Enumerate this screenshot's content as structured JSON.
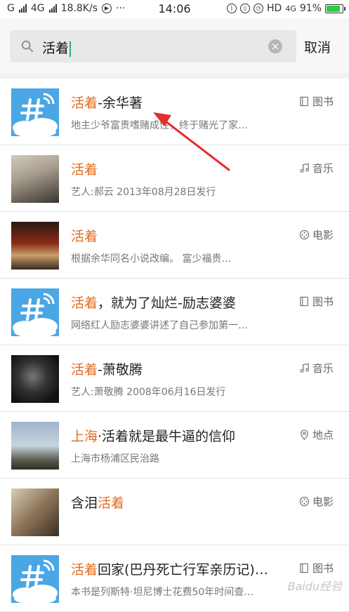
{
  "status_bar": {
    "carrier_left": "G",
    "network": "4G",
    "speed": "18.8K/s",
    "more": "···",
    "time": "14:06",
    "hd_label": "HD",
    "network_right": "4G",
    "battery": "91%",
    "battery_fraction": 0.91
  },
  "search": {
    "icon": "search-icon",
    "query": "活着",
    "clear_icon": "×",
    "cancel_label": "取消"
  },
  "results": [
    {
      "icon": "app-hash-icon",
      "thumb": "app",
      "title_hl": "活着",
      "title_rest": "-余华著",
      "subtitle": "地主少爷富贵嗜赌成性，终于赌光了家…",
      "tag_icon": "book-icon",
      "tag": "图书"
    },
    {
      "icon": "music-icon",
      "thumb": "photo1",
      "title_hl": "活着",
      "title_rest": "",
      "subtitle": "艺人:郝云  2013年08月28日发行",
      "tag_icon": "music-icon",
      "tag": "音乐"
    },
    {
      "icon": "movie-icon",
      "thumb": "movie1",
      "title_hl": "活着",
      "title_rest": "",
      "subtitle": "根据余华同名小说改编。        富少福贵…",
      "tag_icon": "film-icon",
      "tag": "电影"
    },
    {
      "icon": "app-hash-icon",
      "thumb": "app",
      "title_hl": "活着",
      "title_rest": "，就为了灿烂-励志婆婆",
      "subtitle": "网络红人励志婆婆讲述了自己参加第一…",
      "tag_icon": "book-icon",
      "tag": "图书"
    },
    {
      "icon": "music-icon",
      "thumb": "photo2",
      "title_hl": "活着",
      "title_rest": "-萧敬腾",
      "subtitle": "艺人:萧敬腾  2008年06月16日发行",
      "tag_icon": "music-icon",
      "tag": "音乐"
    },
    {
      "icon": "location-icon",
      "thumb": "sky",
      "title_pre": "",
      "title_hl": "上海",
      "title_rest": "·活着就是最牛逼的信仰",
      "subtitle": "上海市杨浦区民治路",
      "tag_icon": "location-icon",
      "tag": "地点"
    },
    {
      "icon": "movie-icon",
      "thumb": "movie2",
      "title_pre": "含泪",
      "title_hl": "活着",
      "title_rest": "",
      "subtitle": "",
      "tag_icon": "film-icon",
      "tag": "电影"
    },
    {
      "icon": "app-hash-icon",
      "thumb": "app",
      "title_hl": "活着",
      "title_rest": "回家(巴丹死亡行军亲历记)…",
      "subtitle": "本书是列斯特·坦尼博士花费50年时间查…",
      "tag_icon": "book-icon",
      "tag": "图书"
    }
  ],
  "watermark": "Baidu经验"
}
